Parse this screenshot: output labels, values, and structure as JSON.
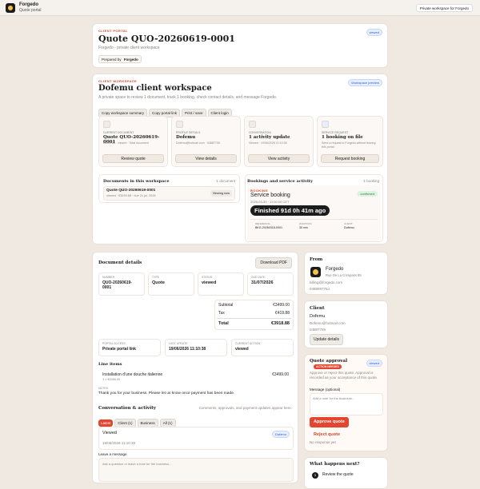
{
  "topbar": {
    "brand": "Forgedo",
    "subtitle": "Quote portal",
    "right_button": "Private workspace for Forgedo"
  },
  "quote_header": {
    "eyebrow": "CLIENT PORTAL",
    "title": "Quote QUO-20260619-0001",
    "subtitle": "Forgedo · private client workspace",
    "badge": "viewed",
    "prepared_by_label": "Prepared by",
    "prepared_by": "Forgedo"
  },
  "workspace": {
    "eyebrow": "CLIENT WORKSPACE",
    "title": "Dofemu client workspace",
    "description": "A private space to review 1 document, track 1 booking, check contact details, and message Forgedo.",
    "badge": "Workspace preview",
    "actions": [
      "Copy workspace summary",
      "Copy portal link",
      "Print / save",
      "Client login"
    ],
    "cards": [
      {
        "label": "CURRENT DOCUMENT",
        "title": "Quote QUO-20260619-0001",
        "sub": "€3499.88 · viewed · Total document",
        "button": "Review quote"
      },
      {
        "label": "PROFILE DETAILS",
        "title": "Dofemu",
        "sub": "Dofemu@hotmail.com · 04887755",
        "button": "View details"
      },
      {
        "label": "CONVERSATION",
        "title": "1 activity update",
        "sub": "Viewed · 19/06/2026 11:10:38",
        "button": "View activity"
      },
      {
        "label": "SERVICE REQUEST",
        "title": "1 booking on file",
        "sub": "Send a request to Forgedo without leaving this portal.",
        "button": "Request booking"
      }
    ],
    "docs": {
      "title": "Documents in this workspace",
      "count": "1 document",
      "item_title": "Quote QUO-20260619-0001",
      "item_sub": "viewed · €3499.88 · due 21 jul. 2026",
      "item_btn": "Viewing now"
    },
    "bookings": {
      "title": "Bookings and service activity",
      "count": "1 booking",
      "eyebrow": "BOOKING",
      "name": "Service booking",
      "datetime": "2026-03-30 · 11:00:00 CET",
      "status": "confirmed",
      "finished": "Finished 91d 0h 41m ago",
      "meta": [
        {
          "label": "REFERENCE",
          "value": "BKG-20260318-0001"
        },
        {
          "label": "DURATION",
          "value": "30 min"
        },
        {
          "label": "CLIENT",
          "value": "Dofemu"
        }
      ]
    }
  },
  "details": {
    "title": "Document details",
    "download": "Download PDF",
    "fields": [
      {
        "label": "NUMBER",
        "value": "QUO-20260619-0001"
      },
      {
        "label": "TYPE",
        "value": "Quote"
      },
      {
        "label": "STATUS",
        "value": "viewed"
      },
      {
        "label": "DUE DATE",
        "value": "31/07/2026"
      }
    ],
    "subtotal_label": "Subtotal",
    "subtotal": "€3499.00",
    "tax_label": "Tax",
    "tax": "€419.88",
    "total_label": "Total",
    "total": "€3918.88",
    "access": [
      {
        "label": "PORTAL ACCESS",
        "value": "Private portal link"
      },
      {
        "label": "LAST UPDATE",
        "value": "19/06/2026 11:10:38"
      },
      {
        "label": "CURRENT ACTION",
        "value": "viewed"
      }
    ],
    "line_items_title": "Line items",
    "item_name": "Installation d'une douche italienne",
    "item_qty": "1 × €3499.00",
    "item_price": "€3499.00",
    "notes_label": "NOTES",
    "notes": "Thank you for your business. Please let us know once payment has been made.",
    "conv_title": "Conversation & activity",
    "conv_desc": "Comments, approvals, and payment updates appear here.",
    "tabs": [
      "Latest",
      "Client (1)",
      "Business",
      "All (1)"
    ],
    "act_title": "Viewed",
    "act_badge": "Dofemu",
    "act_time": "19/06/2026 11:10:38",
    "leave_msg": "Leave a message",
    "msg_placeholder": "Ask a question or leave a note for the business..."
  },
  "from": {
    "title": "From",
    "name": "Forgedo",
    "address": "Rue De La Compass 85",
    "email": "billing@forgedo.com",
    "phone": "0488997764"
  },
  "client": {
    "title": "Client",
    "name": "Dofemu",
    "email": "Dofemu@hotmail.com",
    "phone": "04887755",
    "button": "Update details"
  },
  "approval": {
    "title": "Quote approval",
    "flag": "ACTION NEEDED",
    "badge": "viewed",
    "desc": "Approve or reject this quote. Approval is recorded as your acceptance of this quote.",
    "msg_label": "Message (optional)",
    "placeholder": "Add a note for the business...",
    "approve": "Approve quote",
    "reject": "Reject quote",
    "no_response": "No response yet"
  },
  "next": {
    "title": "What happens next?",
    "step_num": "1",
    "step": "Review the quote"
  }
}
